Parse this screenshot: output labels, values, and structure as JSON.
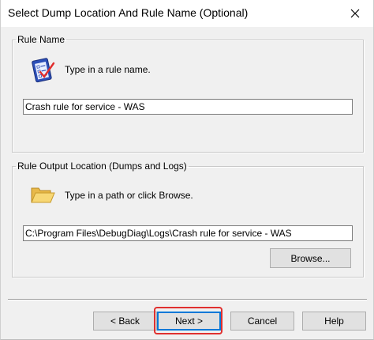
{
  "window": {
    "title": "Select Dump Location And Rule Name (Optional)"
  },
  "rule_name": {
    "group_label": "Rule Name",
    "hint": "Type in a rule name.",
    "value": "Crash rule for service - WAS"
  },
  "output_location": {
    "group_label": "Rule Output Location (Dumps and Logs)",
    "hint": "Type in a path or click Browse.",
    "value": "C:\\Program Files\\DebugDiag\\Logs\\Crash rule for service - WAS",
    "browse_label": "Browse..."
  },
  "footer": {
    "back_label": "< Back",
    "next_label": "Next >",
    "cancel_label": "Cancel",
    "help_label": "Help"
  },
  "colors": {
    "highlight": "#e0302f",
    "default_button_border": "#0078d7"
  }
}
